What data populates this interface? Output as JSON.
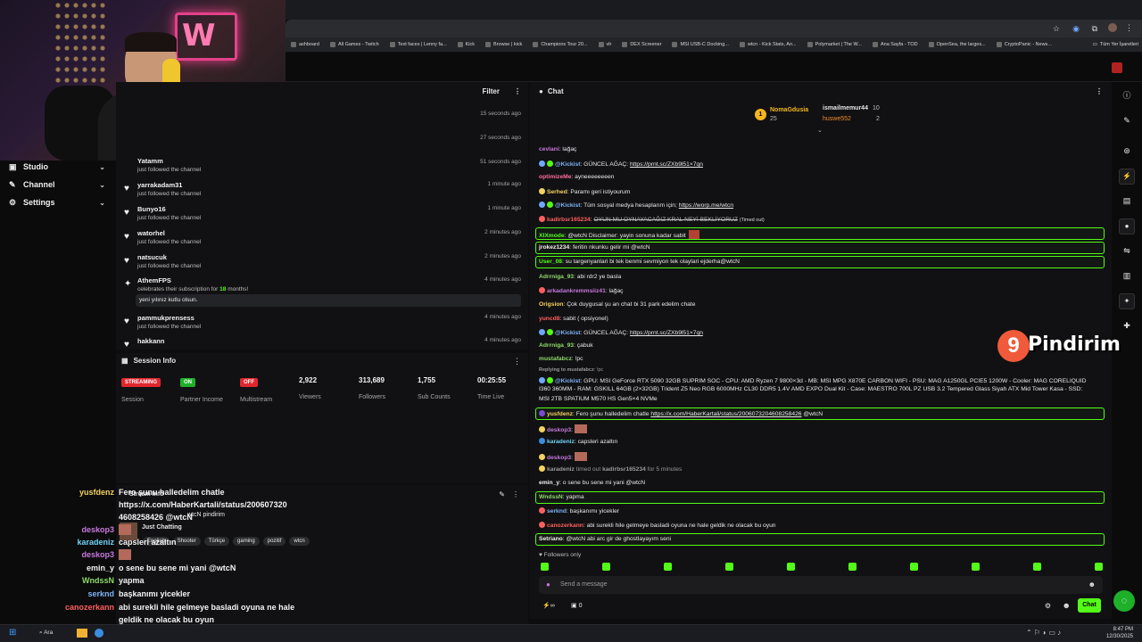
{
  "browser": {
    "bookmarks": [
      "ashboard",
      "All Games - Twitch",
      "Text faces | Lenny fa...",
      "Kick",
      "Browse | kick",
      "Champions Tour 20...",
      "vlr",
      "DEX Screener",
      "MSI USB-C Docking...",
      "wtcn - Kick Stats, An...",
      "Polymarket | The W...",
      "Ana Sayfa - TOD",
      "OpenSea, the larges...",
      "CryptoPanic - News..."
    ],
    "all_bookmarks": "Tüm Yer İşaretleri"
  },
  "nav": {
    "items": [
      {
        "label": "Studio",
        "icon": "studio-icon"
      },
      {
        "label": "Channel",
        "icon": "channel-icon"
      },
      {
        "label": "Settings",
        "icon": "gear-icon"
      }
    ]
  },
  "activity": {
    "filter": "Filter",
    "times_top": [
      "15 seconds ago",
      "27 seconds ago",
      "51 seconds ago"
    ],
    "partial_user": "Yatamm",
    "partial_sub": "just followed the channel",
    "rows": [
      {
        "user": "yarrakadam31",
        "sub": "just followed the channel",
        "time": "1 minute ago"
      },
      {
        "user": "Bunyo16",
        "sub": "just followed the channel",
        "time": "1 minute ago"
      },
      {
        "user": "watorhel",
        "sub": "just followed the channel",
        "time": "2 minutes ago"
      },
      {
        "user": "natsucuk",
        "sub": "just followed the channel",
        "time": "2 minutes ago"
      },
      {
        "user": "AthemFPS",
        "sub": "celebrates their subscription for",
        "count": "18",
        "sub_end": "months!",
        "time": "4 minutes ago"
      },
      {
        "user": "pammukprensess",
        "sub": "just followed the channel",
        "time": "4 minutes ago"
      },
      {
        "user": "hakkann",
        "sub": "",
        "time": "4 minutes ago"
      }
    ],
    "sub_message": "yeni yılınız kutlu olsun."
  },
  "session": {
    "title": "Session Info",
    "stats": [
      {
        "pill": "STREAMING",
        "color": "#e0272e",
        "label": "Session"
      },
      {
        "pill": "ON",
        "color": "#1fb02a",
        "label": "Partner Income"
      },
      {
        "pill": "OFF",
        "color": "#e0272e",
        "label": "Multistream"
      },
      {
        "value": "2,922",
        "label": "Viewers"
      },
      {
        "value": "313,689",
        "label": "Followers"
      },
      {
        "value": "1,755",
        "label": "Sub Counts"
      },
      {
        "value": "00:25:55",
        "label": "Time Live"
      }
    ]
  },
  "stream_info": {
    "title": "Stream Info",
    "streamer": "wtcN pindirim",
    "category": "Just Chatting",
    "tags": [
      "English",
      "Shooter",
      "Türkçe",
      "gaming",
      "pozitif",
      "wtcn"
    ]
  },
  "overlay": [
    {
      "name": "yusfdenz",
      "color": "#f4d35e",
      "msg": "Fero şunu halledelim chatle"
    },
    {
      "name": "",
      "color": "#fff",
      "msg": "https://x.com/HaberKartali/status/200607320"
    },
    {
      "name": "",
      "color": "#fff",
      "msg": "4608258426 @wtcN"
    },
    {
      "name": "deskop3",
      "color": "#c678dd",
      "msg": ""
    },
    {
      "name": "karadeniz",
      "color": "#6fd3f5",
      "msg": "capsleri azaltın"
    },
    {
      "name": "deskop3",
      "color": "#c678dd",
      "msg": ""
    },
    {
      "name": "emin_y",
      "color": "#f0f0f0",
      "msg": "o sene bu sene mi yani @wtcN"
    },
    {
      "name": "WndssN",
      "color": "#8fd96a",
      "msg": "yapma"
    },
    {
      "name": "serknd",
      "color": "#7fb3f5",
      "msg": "başkanımı yicekler"
    },
    {
      "name": "canozerkann",
      "color": "#ff5f5f",
      "msg": "abi surekli hile gelmeye basladi oyuna ne hale"
    },
    {
      "name": "",
      "color": "#fff",
      "msg": "geldik ne olacak bu oyun"
    },
    {
      "name": "Setriano",
      "color": "#f0f0f0",
      "msg": "@wtcN abi arc gir de ghostlayayım seni"
    }
  ],
  "chat": {
    "title": "Chat",
    "leaderboard": [
      {
        "name": "NomaGdusia",
        "count": "25"
      },
      {
        "name": "ismailmemur44",
        "count": "10"
      },
      {
        "name": "huswe552",
        "count": "2"
      }
    ],
    "messages": [
      {
        "user": "cevlani",
        "color": "#c678dd",
        "text": "lağaç"
      },
      {
        "user": "@Kickist",
        "color": "#7fb3f5",
        "text": "GÜNCEL AĞAÇ:",
        "link": "https://prnt.sc/ZXb9l51×7qn"
      },
      {
        "user": "optimizeMe",
        "color": "#ff6b9a",
        "text": "ayneeeeeeeen"
      },
      {
        "user": "Serhed",
        "color": "#f4d35e",
        "text": "Paramı geri istiyourum"
      },
      {
        "user": "@Kickist",
        "color": "#7fb3f5",
        "text": "Tüm sosyal medya hesaplarım için;",
        "link": "https://worp.me/wtcn"
      },
      {
        "user": "kadirbsr165234",
        "color": "#ff5f5f",
        "text": "OYUN MU OYNAYACAĞIZ KRAL NEYİ BEKLİYORUZ",
        "note": "(Timed out)"
      },
      {
        "user": "XIXmode",
        "color": "#53fc18",
        "text": "@wtcN Disclaimer: yayin sonuna kadar sabit"
      },
      {
        "user": "jrokez1234",
        "color": "#f0f0f0",
        "text": "feritin nkunku gelir mi @wtcN"
      },
      {
        "user": "User_08",
        "color": "#53fc18",
        "text": "su targenyanlari bi tek benmi sevmiyon tek olaylari ejderha@wtcN"
      },
      {
        "user": "Adrrniga_93",
        "color": "#8fd96a",
        "text": "abi rdr2 ye basla"
      },
      {
        "user": "arkadankremmsiiz41",
        "color": "#c678dd",
        "text": "lağaç"
      },
      {
        "user": "Origsion",
        "color": "#f4d35e",
        "text": "Çok duygusal şu an chat bi 31 park edelim chate"
      },
      {
        "user": "yuncd8",
        "color": "#ff5f5f",
        "text": "sabit ( opsiyonel)"
      },
      {
        "user": "@Kickist",
        "color": "#7fb3f5",
        "text": "GÜNCEL AĞAÇ:",
        "link": "https://prnt.sc/ZXb9l51×7qn"
      },
      {
        "user": "Adrrniga_93",
        "color": "#8fd96a",
        "text": "çabuk"
      },
      {
        "user": "mustafabcz",
        "color": "#8fd96a",
        "text": "!pc"
      },
      {
        "user": "Replying to mustafabcz",
        "color": "#9a9a9a",
        "text": "!pc"
      },
      {
        "user": "@Kickist",
        "color": "#7fb3f5",
        "text": "GPU: MSI GeForce RTX 5090 32GB SUPRIM SOC - CPU: AMD Ryzen 7 9800×3d - MB: MSI MPG X870E CARBON WIFI - PSU: MAG A1250GL PCIE5 1200W - Cooler: MAG CORELIQUID"
      },
      {
        "user": "",
        "color": "#fff",
        "text": "I360 360MM - RAM: GSKILL 64GB (2×32GB) Trident Z5 Neo RGB 6000MHz CL30 DDR5 1.4V AMD EXPO Dual Kit - Case: MAESTRO 700L PZ USB 3.2 Tempered Glass Siyah ATX Mid Tower Kasa - SSD:"
      },
      {
        "user": "",
        "color": "#fff",
        "text": "MSI 2TB SPATIUM M570 HS Gen5×4 NVMe"
      },
      {
        "user": "yusfdenz",
        "color": "#f4d35e",
        "text": "Fero şunu halledelim chatle",
        "link": "https://x.com/HaberKartali/status/2006073204608258426",
        "tail": "@wtcN"
      },
      {
        "user": "deskop3",
        "color": "#c678dd",
        "text": ""
      },
      {
        "user": "karadeniz",
        "color": "#6fd3f5",
        "text": "capsleri azaltın"
      },
      {
        "user": "deskop3",
        "color": "#c678dd",
        "text": ""
      },
      {
        "user": "karadeniz",
        "color": "#9a9a9a",
        "text": "timed out",
        "target": "kadirbsr165234",
        "tail": "for 5 minutes"
      },
      {
        "user": "emin_y",
        "color": "#f0f0f0",
        "text": "o sene bu sene mi yani @wtcN"
      },
      {
        "user": "WndssN",
        "color": "#8fd96a",
        "text": "yapma"
      },
      {
        "user": "serknd",
        "color": "#7fb3f5",
        "text": "başkanımı yicekler"
      },
      {
        "user": "canozerkann",
        "color": "#ff5f5f",
        "text": "abi surekli hile gelmeye basladi oyuna ne hale geldik ne olacak bu oyun"
      },
      {
        "user": "Setriano",
        "color": "#f0f0f0",
        "text": "@wtcN abi arc gir de ghostlayayım seni"
      }
    ],
    "followers_only": "Followers only",
    "placeholder": "Send a message",
    "points": "0",
    "send": "Chat"
  },
  "watermark": "Pindirim",
  "taskbar": {
    "search": "Ara",
    "time": "8:47 PM",
    "date": "12/30/2025"
  },
  "colors": {
    "accent": "#53fc18",
    "bg": "#111113"
  }
}
